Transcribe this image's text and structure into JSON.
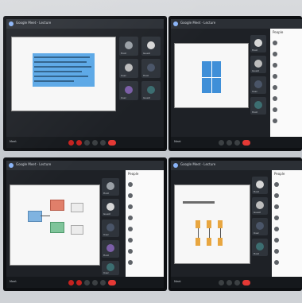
{
  "screens": [
    {
      "title": "Google Meet - Lecture",
      "slide": {
        "heading": "",
        "caption": ""
      },
      "participants": [
        "Host",
        "Guest",
        "User",
        "Host",
        "User",
        "Guest"
      ],
      "meeting": {
        "name": "Meet",
        "time": ""
      },
      "panel": null
    },
    {
      "title": "Google Meet - Lecture",
      "slide": {
        "heading": "",
        "caption": ""
      },
      "participants": [
        "Host",
        "Guest",
        "User",
        "Host"
      ],
      "meeting": {
        "name": "Meet",
        "time": ""
      },
      "panel": {
        "title": "People",
        "items": [
          "",
          "",
          "",
          "",
          "",
          "",
          "",
          ""
        ]
      }
    },
    {
      "title": "Google Meet - Lecture",
      "slide": {
        "heading": "",
        "caption": ""
      },
      "participants": [
        "Host",
        "Guest",
        "User",
        "Host",
        "User"
      ],
      "meeting": {
        "name": "Meet",
        "time": ""
      },
      "panel": {
        "title": "People",
        "items": [
          "",
          "",
          "",
          "",
          "",
          "",
          "",
          ""
        ]
      }
    },
    {
      "title": "Google Meet - Lecture",
      "slide": {
        "heading": "",
        "caption": ""
      },
      "participants": [
        "Host",
        "Guest",
        "User",
        "Host"
      ],
      "meeting": {
        "name": "Meet",
        "time": ""
      },
      "panel": {
        "title": "People",
        "items": [
          "",
          "",
          "",
          "",
          "",
          "",
          "",
          ""
        ]
      }
    }
  ],
  "colors": {
    "toolbar": "#15181c",
    "end_call": "#e53935",
    "accent": "#8ab4f8"
  },
  "icons": [
    "mic-icon",
    "camera-icon",
    "present-icon",
    "raise-hand-icon",
    "more-icon",
    "end-call-icon"
  ]
}
